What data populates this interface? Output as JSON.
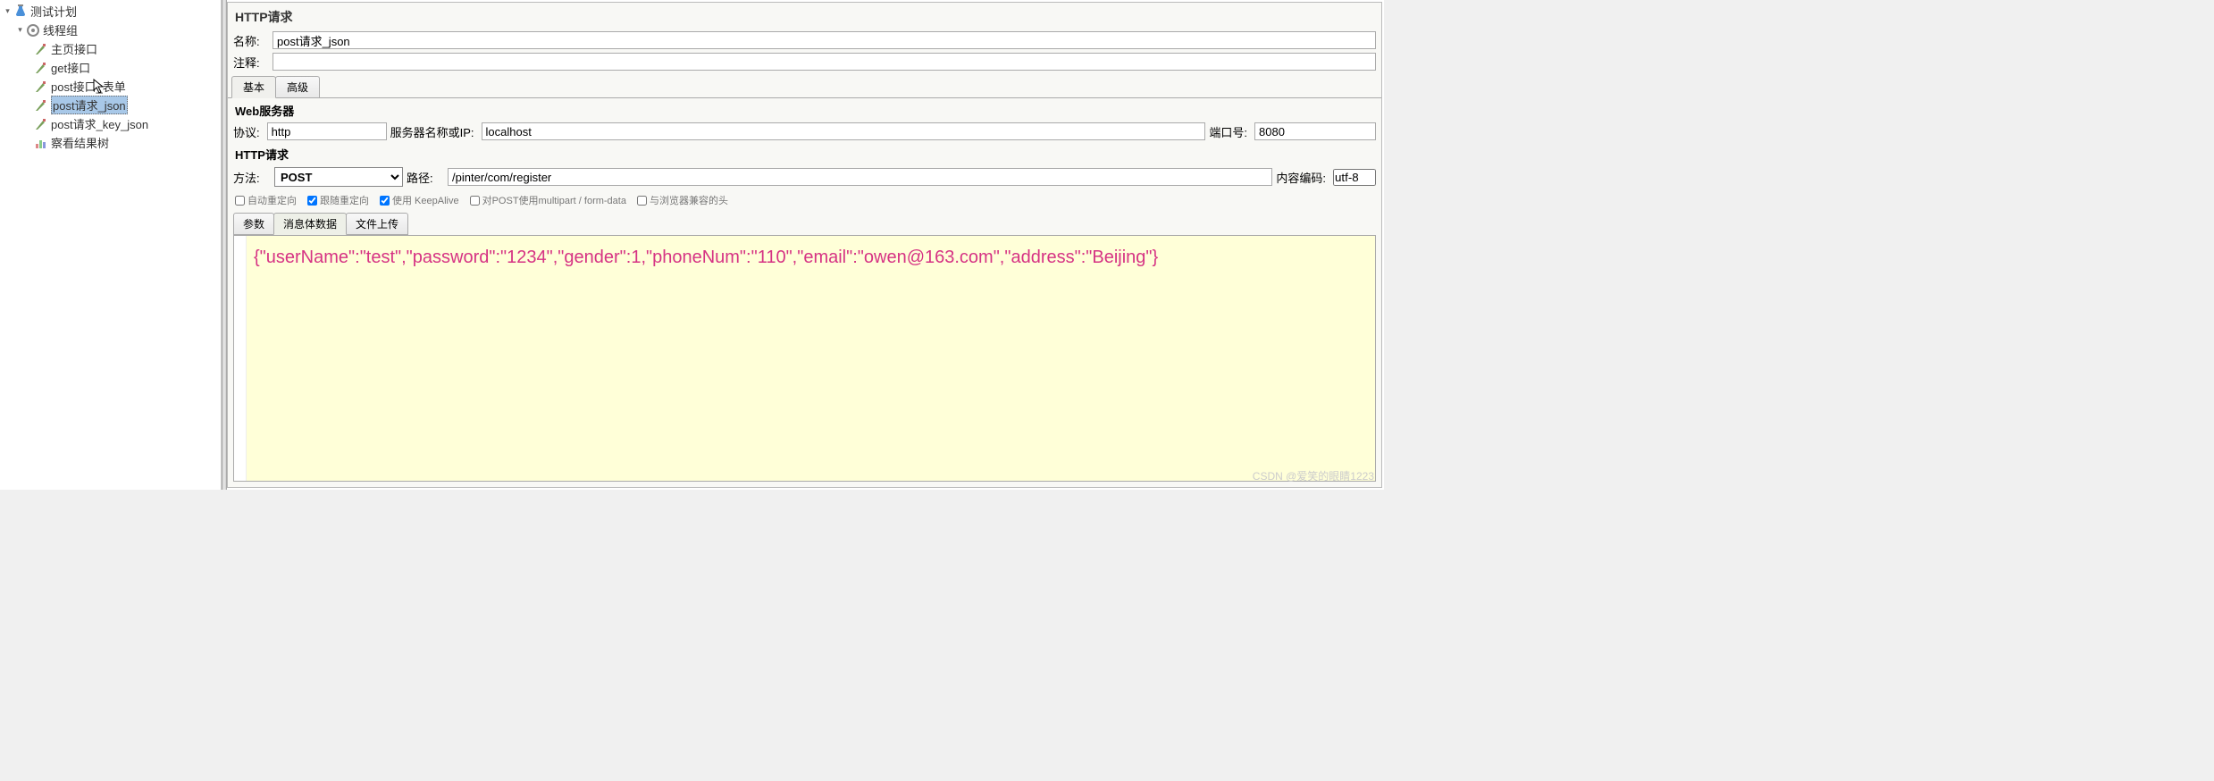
{
  "tree": {
    "root": "测试计划",
    "group": "线程组",
    "items": [
      "主页接口",
      "get接口",
      "post接口_表单",
      "post请求_json",
      "post请求_key_json"
    ],
    "results": "察看结果树",
    "selected_index": 3
  },
  "panel": {
    "title": "HTTP请求",
    "name_label": "名称:",
    "name_value": "post请求_json",
    "comment_label": "注释:",
    "comment_value": ""
  },
  "top_tabs": {
    "basic": "基本",
    "advanced": "高级"
  },
  "web_server": {
    "section": "Web服务器",
    "proto_label": "协议:",
    "proto_value": "http",
    "host_label": "服务器名称或IP:",
    "host_value": "localhost",
    "port_label": "端口号:",
    "port_value": "8080"
  },
  "http_request": {
    "section": "HTTP请求",
    "method_label": "方法:",
    "method_value": "POST",
    "path_label": "路径:",
    "path_value": "/pinter/com/register",
    "enc_label": "内容编码:",
    "enc_value": "utf-8"
  },
  "checkboxes": {
    "auto_redirect": "自动重定向",
    "follow_redirect": "跟随重定向",
    "keep_alive": "使用 KeepAlive",
    "multipart": "对POST使用multipart / form-data",
    "browser_headers": "与浏览器兼容的头"
  },
  "body_tabs": {
    "params": "参数",
    "body": "消息体数据",
    "upload": "文件上传"
  },
  "body_content": {
    "raw": "{\"userName\":\"test\",\"password\":\"1234\",\"gender\":1,\"phoneNum\":\"110\",\"email\":\"owen@163.com\",\"address\":\"Beijing\"}"
  },
  "watermark": "CSDN @爱笑的眼睛1223"
}
